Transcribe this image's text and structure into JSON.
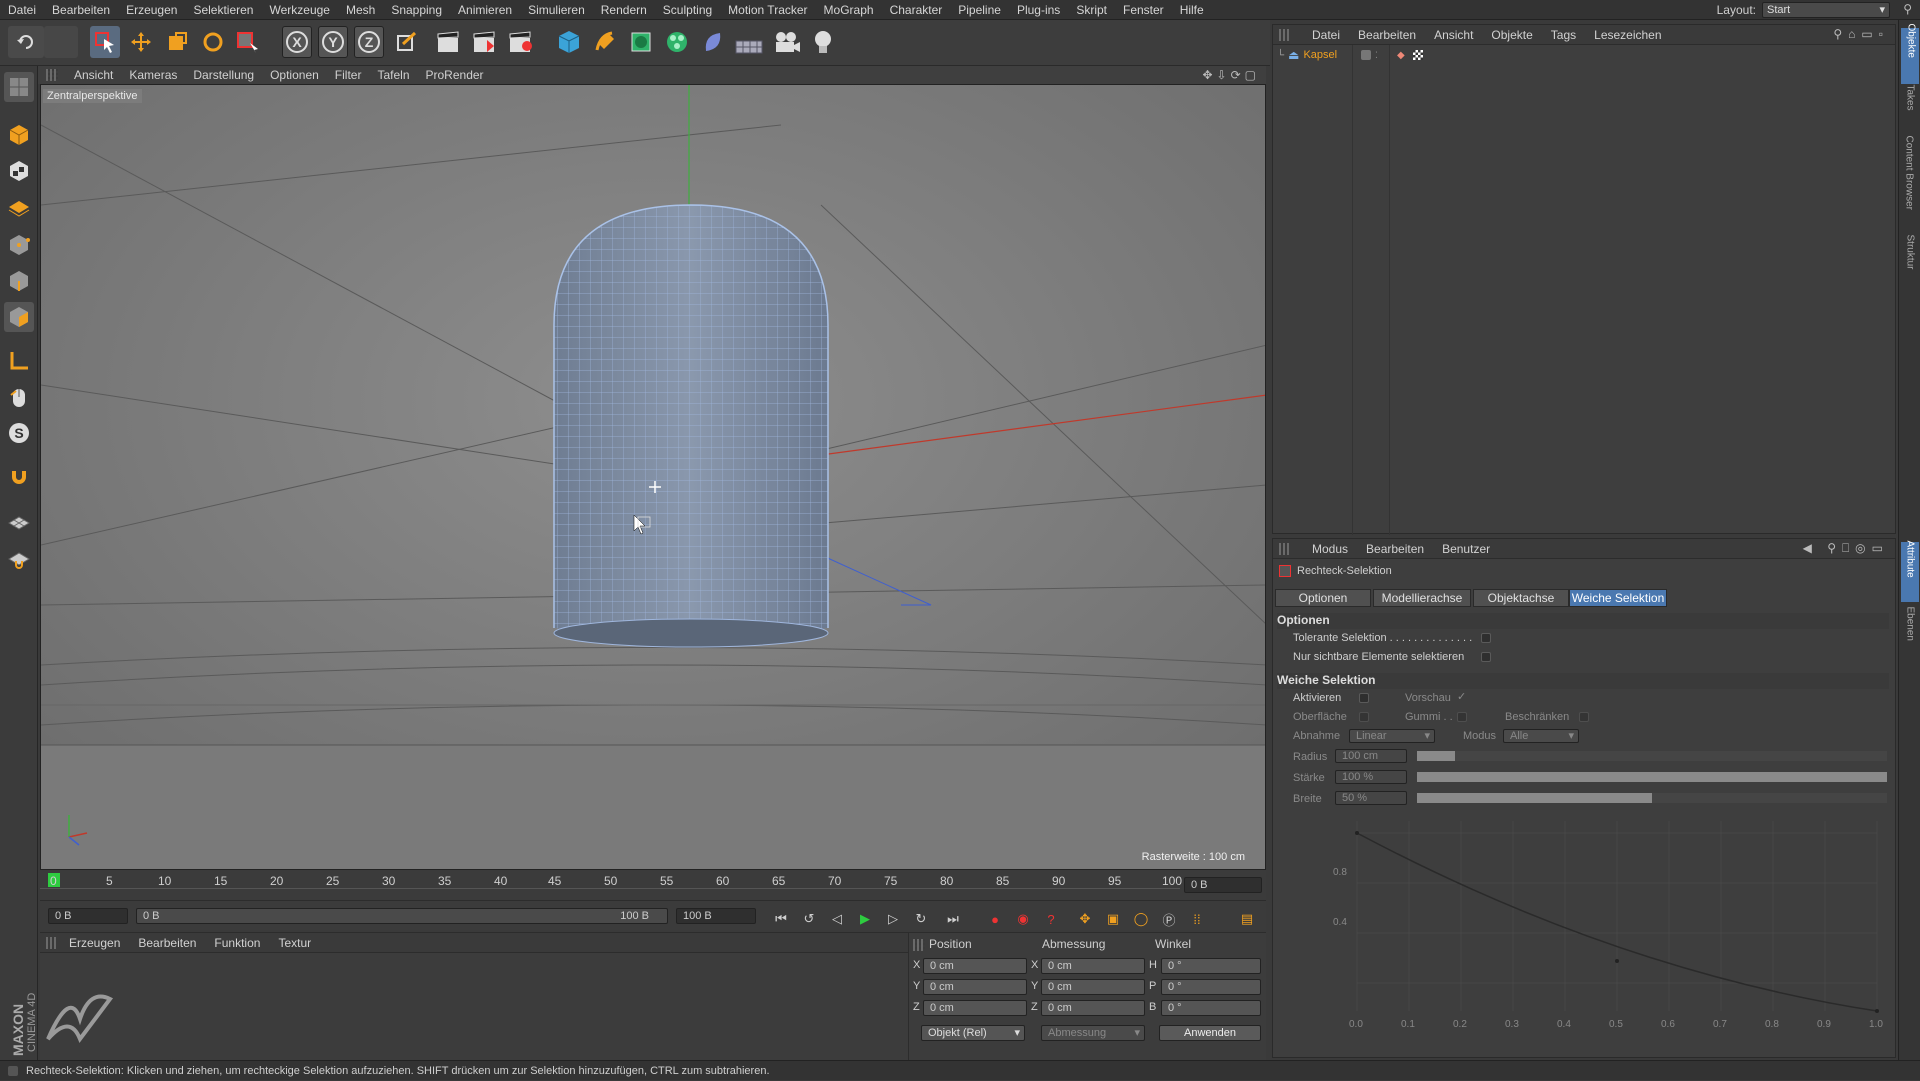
{
  "menu": [
    "Datei",
    "Bearbeiten",
    "Erzeugen",
    "Selektieren",
    "Werkzeuge",
    "Mesh",
    "Snapping",
    "Animieren",
    "Simulieren",
    "Rendern",
    "Sculpting",
    "Motion Tracker",
    "MoGraph",
    "Charakter",
    "Pipeline",
    "Plug-ins",
    "Skript",
    "Fenster",
    "Hilfe"
  ],
  "layout": {
    "label": "Layout:",
    "value": "Start"
  },
  "toolbar": {
    "x_label": "X",
    "y_label": "Y",
    "z_label": "Z"
  },
  "viewport": {
    "menu": [
      "Ansicht",
      "Kameras",
      "Darstellung",
      "Optionen",
      "Filter",
      "Tafeln",
      "ProRender"
    ],
    "camera_label": "Zentralperspektive",
    "grid_label": "Rasterweite : 100 cm"
  },
  "timeline": {
    "ticks": [
      "0",
      "5",
      "10",
      "15",
      "20",
      "25",
      "30",
      "35",
      "40",
      "45",
      "50",
      "55",
      "60",
      "65",
      "70",
      "75",
      "80",
      "85",
      "90",
      "95",
      "100"
    ],
    "current_frame": "0 B",
    "start_field": "0 B",
    "range_start": "0 B",
    "range_end": "100 B",
    "end_field": "100 B"
  },
  "material_panel": {
    "menu": [
      "Erzeugen",
      "Bearbeiten",
      "Funktion",
      "Textur"
    ]
  },
  "coords": {
    "headers": [
      "Position",
      "Abmessung",
      "Winkel"
    ],
    "rows": [
      {
        "axis": "X",
        "pos": "0 cm",
        "dim_axis": "X",
        "dim": "0 cm",
        "ang_axis": "H",
        "ang": "0 °"
      },
      {
        "axis": "Y",
        "pos": "0 cm",
        "dim_axis": "Y",
        "dim": "0 cm",
        "ang_axis": "P",
        "ang": "0 °"
      },
      {
        "axis": "Z",
        "pos": "0 cm",
        "dim_axis": "Z",
        "dim": "0 cm",
        "ang_axis": "B",
        "ang": "0 °"
      }
    ],
    "mode": "Objekt (Rel)",
    "size_mode": "Abmessung",
    "apply": "Anwenden"
  },
  "object_manager": {
    "menu": [
      "Datei",
      "Bearbeiten",
      "Ansicht",
      "Objekte",
      "Tags",
      "Lesezeichen"
    ],
    "objects": [
      {
        "name": "Kapsel"
      }
    ]
  },
  "attribute_manager": {
    "menu": [
      "Modus",
      "Bearbeiten",
      "Benutzer"
    ],
    "tool_name": "Rechteck-Selektion",
    "tabs": [
      "Optionen",
      "Modellierachse",
      "Objektachse",
      "Weiche Selektion"
    ],
    "section_options": "Optionen",
    "opt_tolerant": "Tolerante Selektion . . . . . . . . . . . . . .",
    "opt_visible": "Nur sichtbare Elemente selektieren",
    "section_soft": "Weiche Selektion",
    "soft": {
      "aktivieren": "Aktivieren",
      "vorschau": "Vorschau",
      "vorschau_check": "✓",
      "oberflaeche": "Oberfläche",
      "gummi": "Gummi . .",
      "beschraenken": "Beschränken",
      "abnahme": "Abnahme",
      "abnahme_val": "Linear",
      "modus": "Modus",
      "modus_val": "Alle",
      "radius": "Radius",
      "radius_val": "100 cm",
      "staerke": "Stärke",
      "staerke_val": "100 %",
      "breite": "Breite",
      "breite_val": "50 %"
    },
    "graph": {
      "y_ticks": [
        "0.8",
        "0.4"
      ],
      "x_ticks": [
        "0.0",
        "0.1",
        "0.2",
        "0.3",
        "0.4",
        "0.5",
        "0.6",
        "0.7",
        "0.8",
        "0.9",
        "1.0"
      ]
    }
  },
  "right_tabs": [
    "Objekte",
    "Takes",
    "Content Browser",
    "Struktur",
    "Attribute",
    "Ebenen"
  ],
  "brand": {
    "line1": "MAXON",
    "line2": "CINEMA 4D"
  },
  "status": "Rechteck-Selektion: Klicken und ziehen, um rechteckige Selektion aufzuziehen. SHIFT drücken um zur Selektion hinzuzufügen, CTRL zum subtrahieren.",
  "colors": {
    "accent": "#4a78b0",
    "x_axis": "#c0392b",
    "y_axis": "#3fae3f",
    "z_axis": "#3f5fd0",
    "timeline_marker": "#2ecc40"
  }
}
